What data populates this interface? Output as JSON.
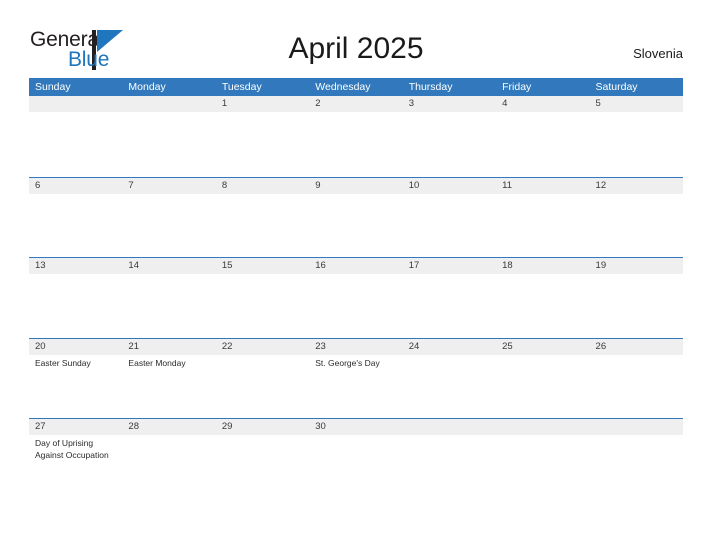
{
  "header": {
    "logo": {
      "text_top": "General",
      "text_bottom": "Blue",
      "flag_icon": "blue-flag-triangle-icon"
    },
    "title": "April 2025",
    "country": "Slovenia"
  },
  "calendar": {
    "weekdays": [
      "Sunday",
      "Monday",
      "Tuesday",
      "Wednesday",
      "Thursday",
      "Friday",
      "Saturday"
    ],
    "colors": {
      "header_blue": "#3179bc",
      "date_band_gray": "#efefef",
      "rule_blue": "#3179bc",
      "brand_blue": "#1f76bc",
      "text_dark": "#2b2b2b"
    },
    "weeks": [
      {
        "dates": [
          "",
          "",
          "1",
          "2",
          "3",
          "4",
          "5"
        ],
        "events": [
          [],
          [],
          [],
          [],
          [],
          [],
          []
        ]
      },
      {
        "dates": [
          "6",
          "7",
          "8",
          "9",
          "10",
          "11",
          "12"
        ],
        "events": [
          [],
          [],
          [],
          [],
          [],
          [],
          []
        ]
      },
      {
        "dates": [
          "13",
          "14",
          "15",
          "16",
          "17",
          "18",
          "19"
        ],
        "events": [
          [],
          [],
          [],
          [],
          [],
          [],
          []
        ]
      },
      {
        "dates": [
          "20",
          "21",
          "22",
          "23",
          "24",
          "25",
          "26"
        ],
        "events": [
          [
            "Easter Sunday"
          ],
          [
            "Easter Monday"
          ],
          [],
          [
            "St. George's Day"
          ],
          [],
          [],
          []
        ]
      },
      {
        "dates": [
          "27",
          "28",
          "29",
          "30",
          "",
          "",
          ""
        ],
        "events": [
          [
            "Day of Uprising",
            "Against Occupation"
          ],
          [],
          [],
          [],
          [],
          [],
          []
        ]
      }
    ]
  }
}
